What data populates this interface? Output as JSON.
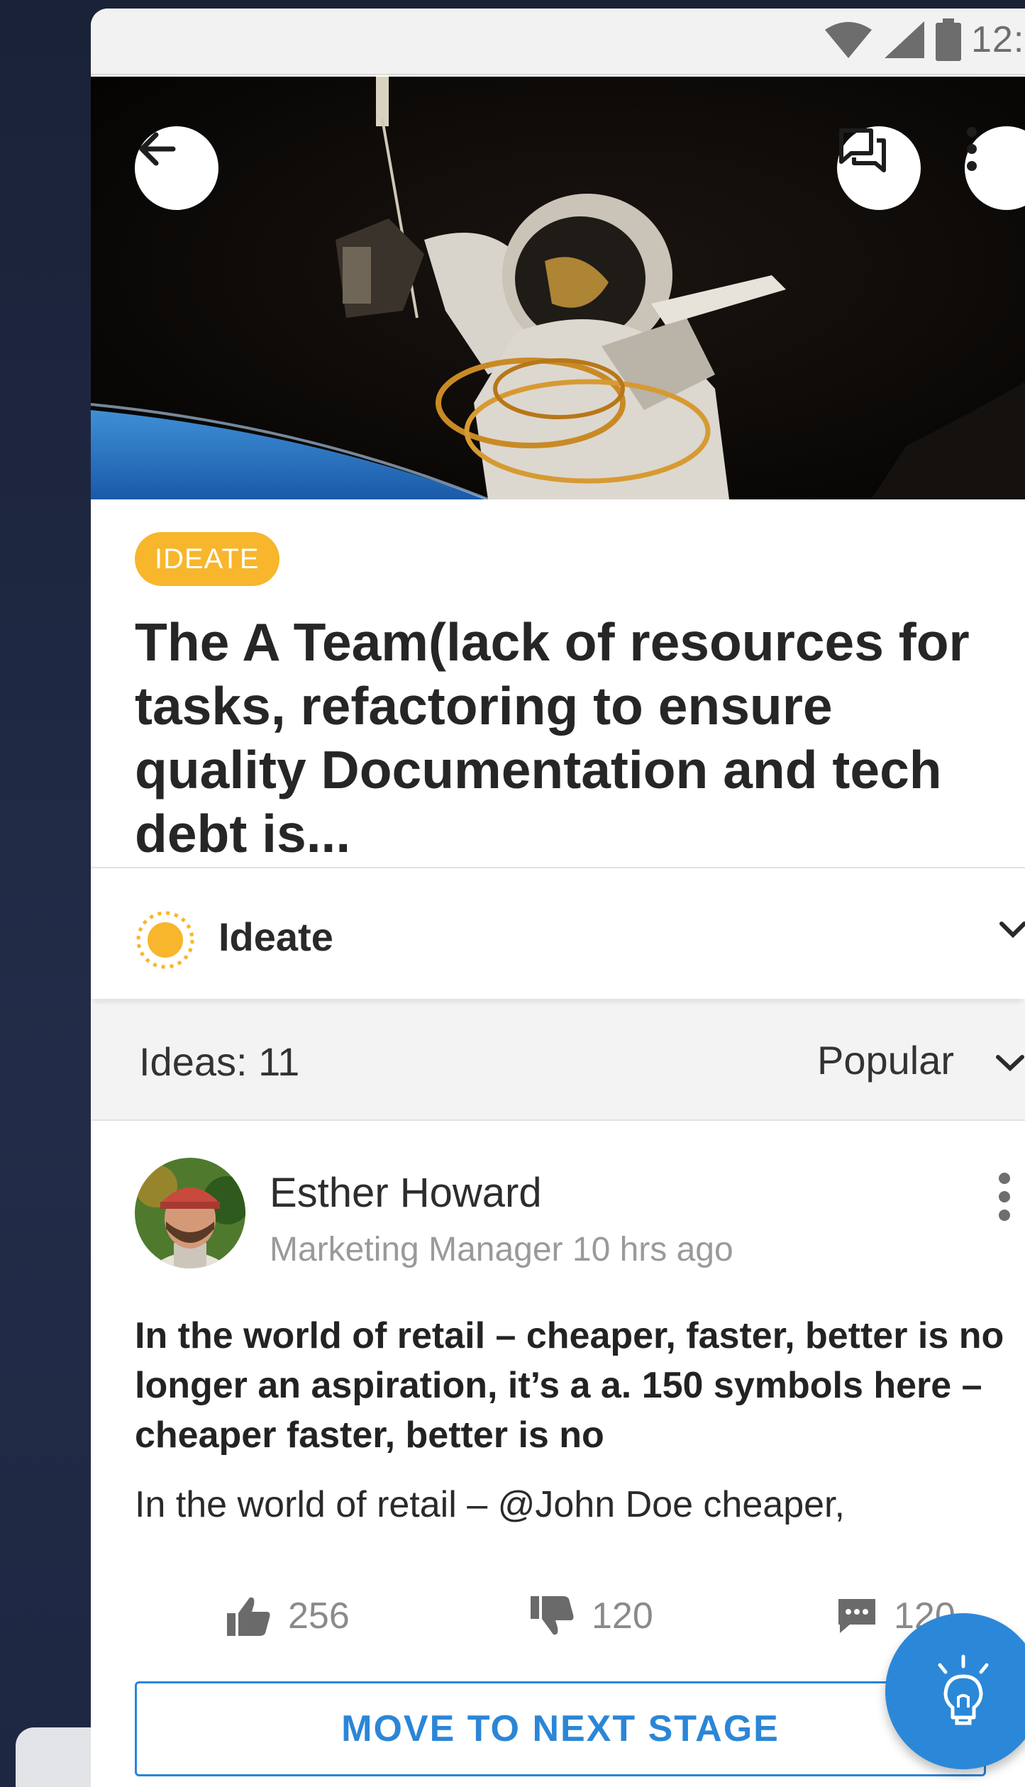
{
  "status_bar": {
    "time": "12:"
  },
  "hero": {
    "icons": [
      "arrow-left-icon",
      "chat-icon",
      "more-vertical-icon"
    ]
  },
  "stage_badge": "IDEATE",
  "title": "The A Team(lack of resources for tasks, refactoring to ensure quality Documentation and tech debt is...",
  "stage_selector": {
    "label": "Ideate",
    "icon": "sun-icon"
  },
  "ideas_bar": {
    "count_label": "Ideas: 11",
    "sort_label": "Popular"
  },
  "post": {
    "author": "Esther Howard",
    "meta": "Marketing Manager 10 hrs ago",
    "body": "In the world of retail – cheaper, faster, better is no longer an aspiration, it’s a a. 150 symbols here – cheaper faster, better is no",
    "body_secondary": "In the world of retail – @John Doe cheaper,",
    "likes": "256",
    "dislikes": "120",
    "comments": "120"
  },
  "actions": {
    "next_stage": "MOVE TO NEXT STAGE"
  },
  "colors": {
    "badge": "#f7b62c",
    "primary": "#2b86d6",
    "background": "#1c2540"
  }
}
